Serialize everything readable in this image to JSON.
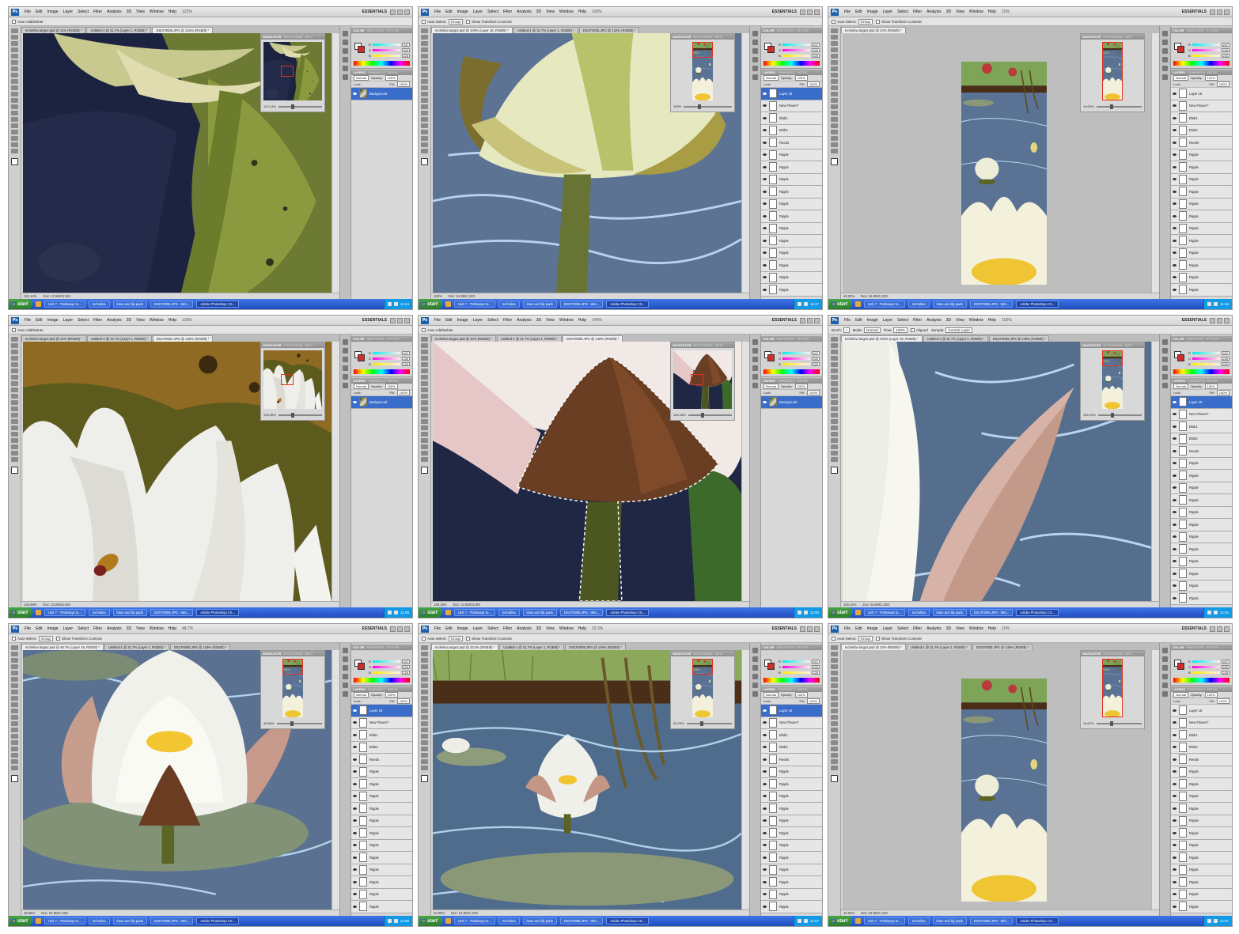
{
  "menu": [
    "File",
    "Edit",
    "Image",
    "Layer",
    "Select",
    "Filter",
    "Analysis",
    "3D",
    "View",
    "Window",
    "Help"
  ],
  "workspace_label": "ESSENTIALS",
  "panel_tabs": {
    "navigator": "NAVIGATOR",
    "histogram": "HISTOGRAM",
    "info": "INFO",
    "color": "COLOR",
    "swatches": "SWATCHES",
    "styles": "STYLES",
    "layers": "LAYERS",
    "channels": "CHANNELS",
    "paths": "PATHS"
  },
  "color_values": {
    "r": "247",
    "g": "226",
    "b": "226"
  },
  "layer_options": {
    "blend": "Normal",
    "opacity_label": "Opacity:",
    "opacity": "100%",
    "lock_label": "Lock:",
    "fill_label": "Fill:",
    "fill": "100%"
  },
  "options": {
    "auto_select": "Auto-Select:",
    "group": "Group",
    "show_transform": "Show Transform Controls",
    "auto_add_delete": "Auto Add/Delete",
    "brush": "Brush:",
    "mode_label": "Mode:",
    "mode_value": "Normal",
    "flow_label": "Flow:",
    "flow_value": "100%",
    "aligned": "Aligned",
    "sample_label": "Sample:",
    "sample_value": "Current Layer"
  },
  "taskbar": {
    "start": "start",
    "items": [
      "Unit 7 - 'Pathways to...",
      "Inchelina",
      "lotus and lily pads",
      "DSCF0006.JPG - Win...",
      "Adobe Photoshop CS..."
    ]
  },
  "layer_names": {
    "background": "Background",
    "layer18": "Layer 18",
    "layer19": "Layer 19",
    "new_flower": "New Flower?",
    "blob1": "Blob1",
    "blob2": "Blob2",
    "reeds": "Reeds",
    "ripple": "Ripple"
  },
  "screens": [
    {
      "zoom": "122%",
      "tabs": [
        "Inchelina large2.psd @ 11% (RGB/8) *",
        "Untitled-1 @ 31.7% (Layer 1, RGB/8) *",
        "DSCF0005.JPG @ 122% (RGB/8) *"
      ],
      "active_tab": 2,
      "status_zoom": "122.14%",
      "doc": "Doc: 22.9M/22.9M",
      "nav_zoom": "122.14%",
      "time": "11:44"
    },
    {
      "zoom": "100%",
      "tabs": [
        "Inchelina large2.psd @ 100% (Layer 18, RGB/8) *",
        "Untitled-1 @ 31.7% (Layer 1, RGB/8) *",
        "DSCF0005.JPG @ 122% (RGB/8) *"
      ],
      "active_tab": 0,
      "status_zoom": "100%",
      "doc": "Doc: 54.8M/1.32G",
      "nav_zoom": "100%",
      "time": "11:47"
    },
    {
      "zoom": "10%",
      "tabs": [
        "Inchelina large2.psd @ 10% (RGB/8) *"
      ],
      "active_tab": 0,
      "status_zoom": "10.02%",
      "doc": "Doc: 54.8M/1.32G",
      "nav_zoom": "10.02%",
      "time": "11:49"
    },
    {
      "zoom": "135%",
      "tabs": [
        "Inchelina large2.psd @ 10% (RGB/8) *",
        "Untitled-1 @ 31.7% (Layer 1, RGB/8) *",
        "DSCF0001.JPG @ 135% (RGB/8) *"
      ],
      "active_tab": 2,
      "status_zoom": "134.99%",
      "doc": "Doc: 22.8M/22.8M",
      "nav_zoom": "134.99%",
      "time": "11:58"
    },
    {
      "zoom": "149%",
      "tabs": [
        "Inchelina large2.psd @ 10% (RGB/8) *",
        "Untitled-1 @ 31.7% (Layer 1, RGB/8) *",
        "DSCF0006.JPG @ 149% (RGB/8) *"
      ],
      "active_tab": 2,
      "status_zoom": "149.18%",
      "doc": "Doc: 22.8M/22.8M",
      "nav_zoom": "149.18%",
      "time": "12:00"
    },
    {
      "zoom": "102%",
      "tabs": [
        "Inchelina large2.psd @ 102% (Layer 19, RGB/8) *",
        "Untitled-1 @ 31.7% (Layer 1, RGB/8) *",
        "DSCF0006.JPG @ 149% (RGB/8) *"
      ],
      "active_tab": 0,
      "status_zoom": "102.22%",
      "doc": "Doc: 54.8M/1.32G",
      "nav_zoom": "102.22%",
      "time": "12:04"
    },
    {
      "zoom": "48.7%",
      "tabs": [
        "Inchelina large2.psd @ 48.7% (Layer 19, RGB/8) *",
        "Untitled-1 @ 31.7% (Layer 1, RGB/8) *",
        "DSCF0006.JPG @ 149% (RGB/8) *"
      ],
      "active_tab": 0,
      "status_zoom": "48.66%",
      "doc": "Doc: 54.8M/1.32G",
      "nav_zoom": "48.66%",
      "time": "12:06"
    },
    {
      "zoom": "33.3%",
      "tabs": [
        "Inchelina large2.psd @ 33.3% (RGB/8) *",
        "Untitled-1 @ 31.7% (Layer 1, RGB/8) *",
        "DSCF0006.JPG @ 149% (RGB/8) *"
      ],
      "active_tab": 0,
      "status_zoom": "33.29%",
      "doc": "Doc: 54.8M/1.32G",
      "nav_zoom": "33.29%",
      "time": "12:07"
    },
    {
      "zoom": "10%",
      "tabs": [
        "Inchelina large2.psd @ 10% (RGB/8) *",
        "Untitled-1 @ 31.7% (Layer 1, RGB/8) *",
        "DSCF0006.JPG @ 149% (RGB/8) *"
      ],
      "active_tab": 0,
      "status_zoom": "10.02%",
      "doc": "Doc: 54.8M/1.32G",
      "nav_zoom": "10.02%",
      "time": "12:07"
    }
  ]
}
